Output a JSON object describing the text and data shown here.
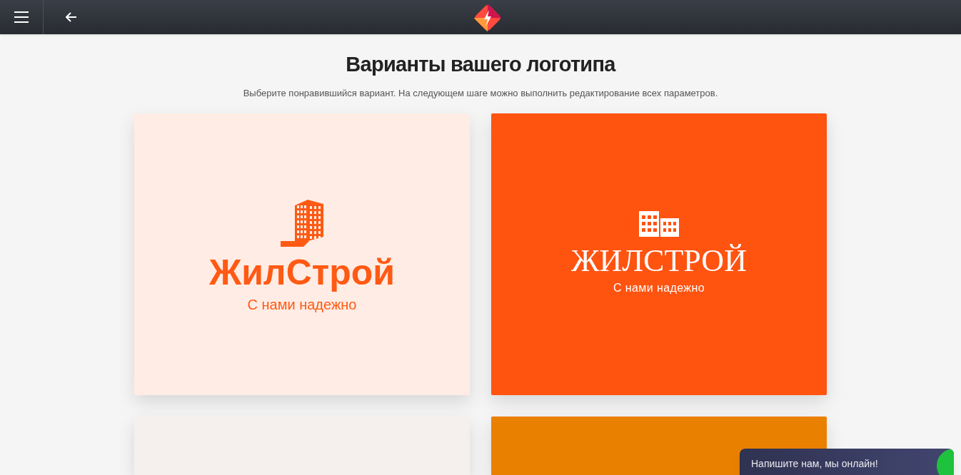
{
  "title": "Варианты вашего логотипа",
  "subtitle": "Выберите понравившийся вариант. На следующем шаге можно выполнить редактирование всех параметров.",
  "cards": [
    {
      "kind": "tower",
      "color": "#ffece4",
      "name": "ЖилСтрой",
      "tagline": "С нами надежно"
    },
    {
      "kind": "blocks",
      "color": "#ff5310",
      "name": "ЖИЛСТРОЙ",
      "tagline": "С нами надежно"
    },
    {
      "kind": "empty",
      "color": "#f5f0ed"
    },
    {
      "kind": "empty",
      "color": "#ea8000"
    }
  ],
  "chat": {
    "label": "Напишите нам, мы онлайн!",
    "online": true
  }
}
